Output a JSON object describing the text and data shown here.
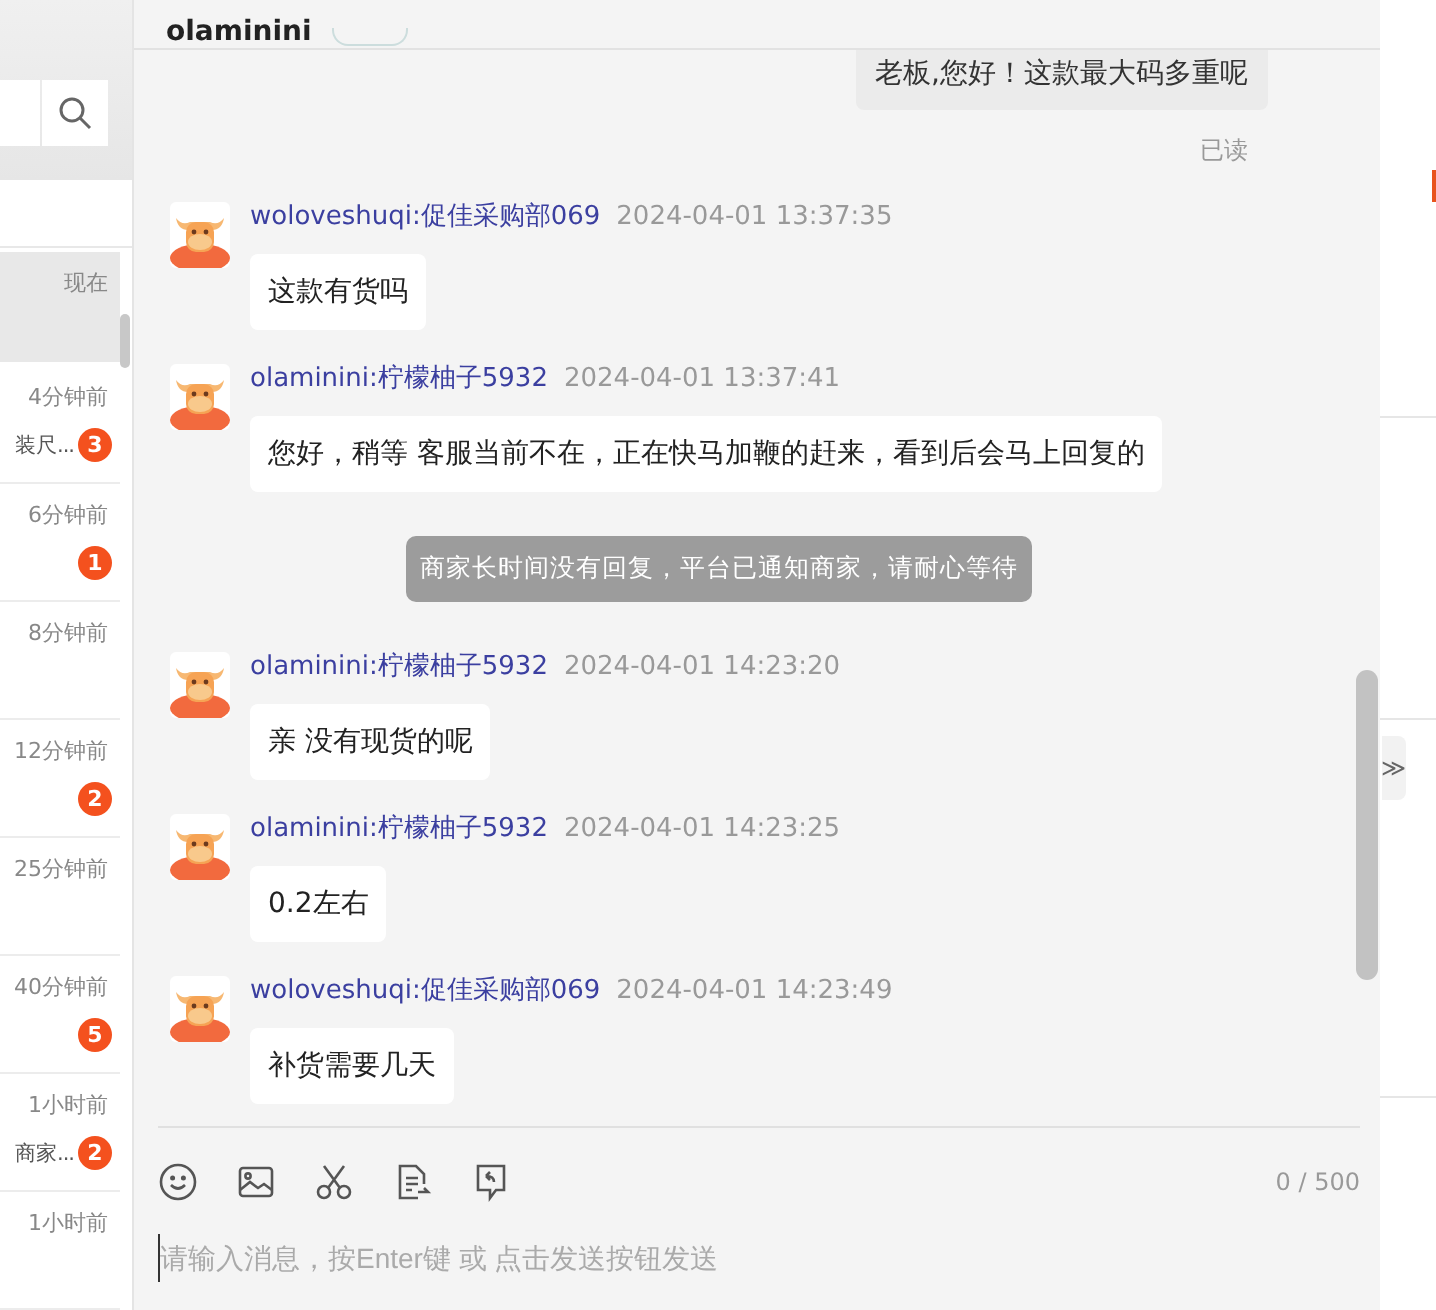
{
  "header": {
    "title": "olaminini"
  },
  "sidebar": {
    "conversations": [
      {
        "time": "现在",
        "selected": true
      },
      {
        "time": "4分钟前",
        "preview": "装尺...",
        "unread": "3",
        "selected": false
      },
      {
        "time": "6分钟前",
        "unread": "1",
        "selected": false
      },
      {
        "time": "8分钟前",
        "selected": false
      },
      {
        "time": "12分钟前",
        "unread": "2",
        "selected": false
      },
      {
        "time": "25分钟前",
        "selected": false
      },
      {
        "time": "40分钟前",
        "unread": "5",
        "selected": false
      },
      {
        "time": "1小时前",
        "preview": "商家...",
        "unread": "2",
        "selected": false
      },
      {
        "time": "1小时前",
        "selected": false
      }
    ]
  },
  "messages": [
    {
      "kind": "own",
      "text": "老板,您好！这款最大码多重呢",
      "status": "已读"
    },
    {
      "kind": "incoming",
      "sender": "woloveshuqi:促佳采购部069",
      "time": "2024-04-01 13:37:35",
      "text": "这款有货吗"
    },
    {
      "kind": "incoming",
      "sender": "olaminini:柠檬柚子5932",
      "time": "2024-04-01 13:37:41",
      "text": "您好，稍等 客服当前不在，正在快马加鞭的赶来，看到后会马上回复的"
    },
    {
      "kind": "notice",
      "text": "商家长时间没有回复，平台已通知商家，请耐心等待"
    },
    {
      "kind": "incoming",
      "sender": "olaminini:柠檬柚子5932",
      "time": "2024-04-01 14:23:20",
      "text": "亲 没有现货的呢"
    },
    {
      "kind": "incoming",
      "sender": "olaminini:柠檬柚子5932",
      "time": "2024-04-01 14:23:25",
      "text": "0.2左右"
    },
    {
      "kind": "incoming",
      "sender": "woloveshuqi:促佳采购部069",
      "time": "2024-04-01 14:23:49",
      "text": "补货需要几天"
    }
  ],
  "composer": {
    "counter": "0 / 500",
    "placeholder": "请输入消息，按Enter键 或 点击发送按钮发送"
  },
  "side_panel": {
    "collapse_button": "≫"
  }
}
